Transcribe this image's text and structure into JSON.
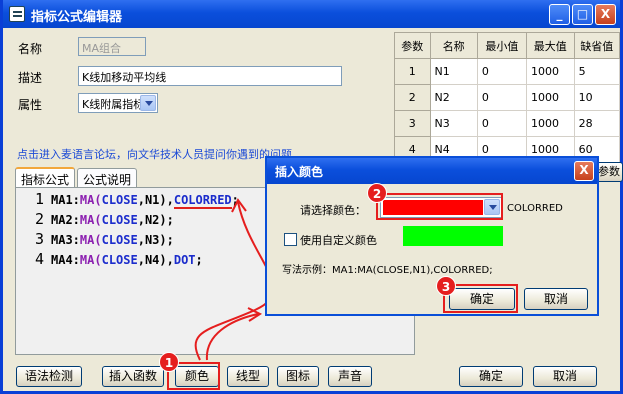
{
  "window": {
    "title": "指标公式编辑器",
    "minimize": "_",
    "maximize": "□",
    "close": "X"
  },
  "form": {
    "name_label": "名称",
    "name_value": "MA组合",
    "desc_label": "描述",
    "desc_value": "K线加移动平均线",
    "attr_label": "属性",
    "attr_value": "K线附属指标"
  },
  "params": {
    "headers": [
      "参数",
      "名称",
      "最小值",
      "最大值",
      "缺省值"
    ],
    "rows": [
      [
        "1",
        "N1",
        "0",
        "1000",
        "5"
      ],
      [
        "2",
        "N2",
        "0",
        "1000",
        "10"
      ],
      [
        "3",
        "N3",
        "0",
        "1000",
        "28"
      ],
      [
        "4",
        "N4",
        "0",
        "1000",
        "60"
      ]
    ],
    "right_tab": "参数"
  },
  "forum_link": "点击进入麦语言论坛，向文华技术人员提问你遇到的问题",
  "tabs": [
    "指标公式",
    "公式说明"
  ],
  "code": {
    "line_numbers": [
      "1",
      "2",
      "3",
      "4"
    ],
    "lines": [
      {
        "name": "MA1:",
        "fn": "MA",
        "args": "(CLOSE,N1)",
        "extra": "COLORRED",
        "end": ";"
      },
      {
        "name": "MA2:",
        "fn": "MA",
        "args": "(CLOSE,N2)",
        "extra": "",
        "end": ";"
      },
      {
        "name": "MA3:",
        "fn": "MA",
        "args": "(CLOSE,N3)",
        "extra": "",
        "end": ";"
      },
      {
        "name": "MA4:",
        "fn": "MA",
        "args": "(CLOSE,N4)",
        "extra": "DOT",
        "end": ";"
      }
    ]
  },
  "bottom_buttons": {
    "syntax": "语法检测",
    "insert_fn": "插入函数",
    "color": "颜色",
    "line_type": "线型",
    "icon": "图标",
    "sound": "声音",
    "ok": "确定",
    "cancel": "取消"
  },
  "dialog": {
    "title": "插入颜色",
    "select_label": "请选择颜色：",
    "color_name": "COLORRED",
    "selected_color": "#ff0000",
    "custom_label": "使用自定义颜色",
    "custom_color": "#00ff00",
    "example": "写法示例：MA1:MA(CLOSE,N1),COLORRED;",
    "ok": "确定",
    "cancel": "取消",
    "close": "X"
  },
  "annotations": [
    "1",
    "2",
    "3"
  ]
}
